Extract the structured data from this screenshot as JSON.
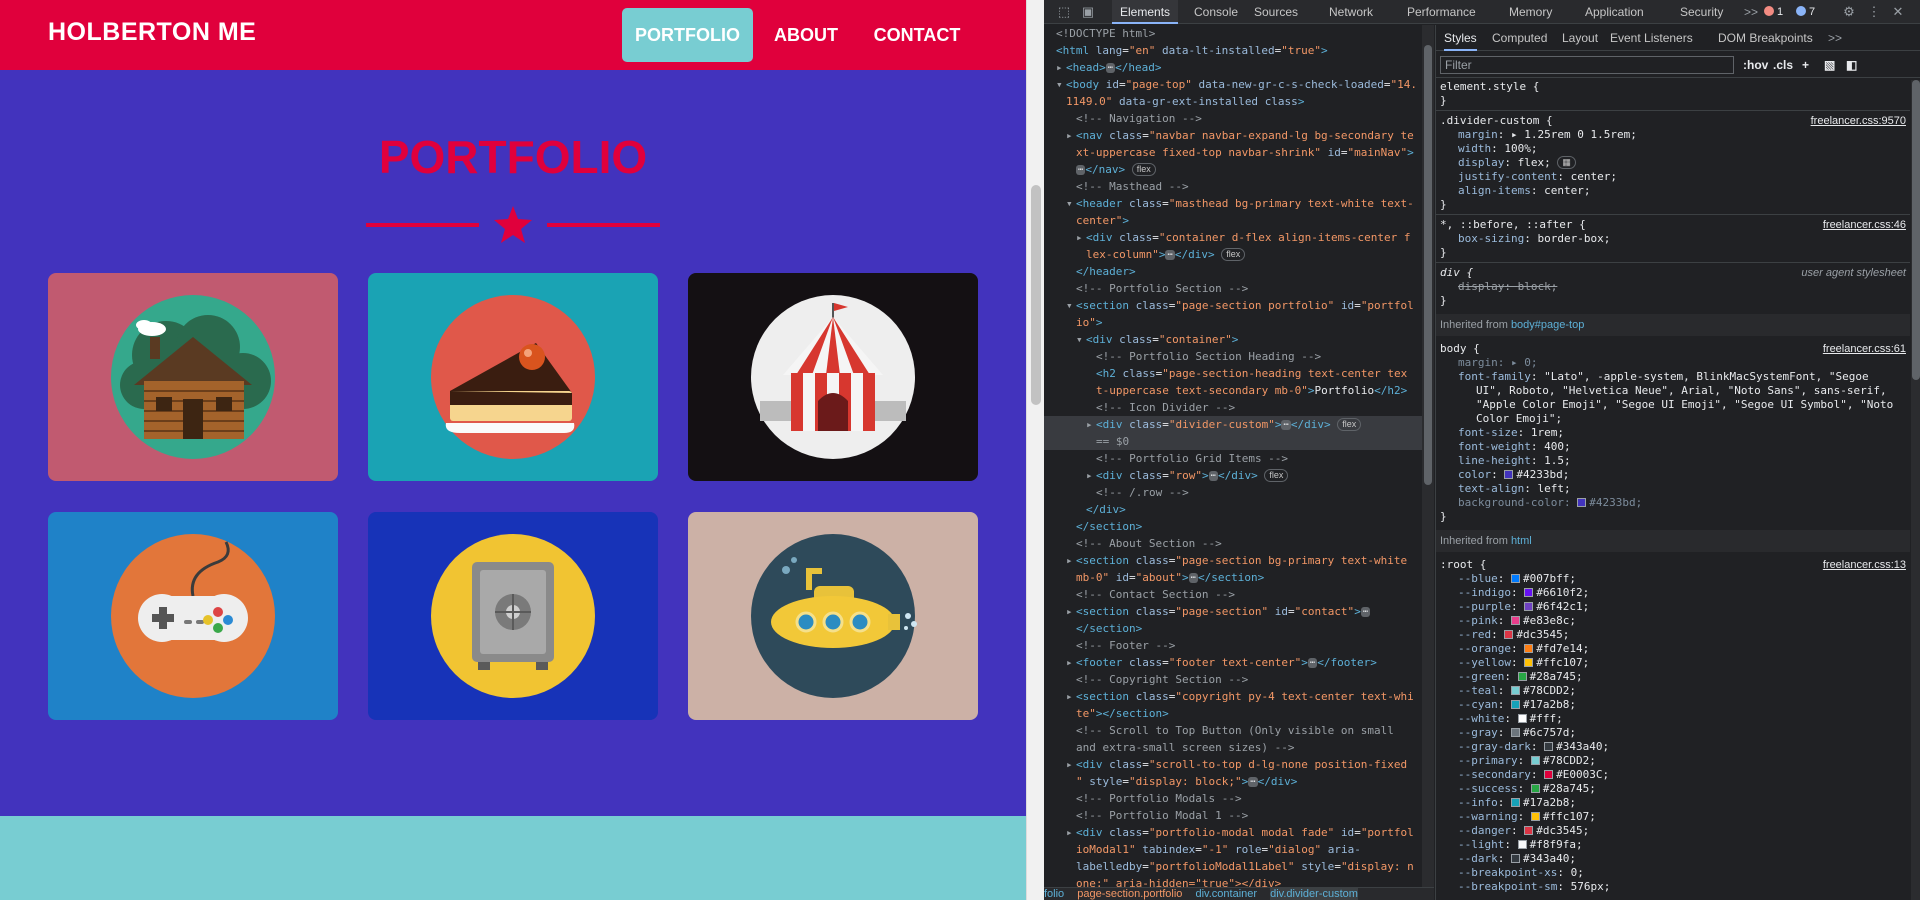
{
  "site": {
    "brand": "HOLBERTON ME",
    "nav": [
      "PORTFOLIO",
      "ABOUT",
      "CONTACT"
    ],
    "heading": "PORTFOLIO",
    "colors": {
      "primary": "#4233bd",
      "secondary": "#e0003c",
      "accent": "#78cdd2"
    },
    "portfolio_items": [
      {
        "name": "cabin",
        "bg": "#c15a70"
      },
      {
        "name": "cake",
        "bg": "#1aa3b4"
      },
      {
        "name": "circus",
        "bg": "#141013"
      },
      {
        "name": "game-controller",
        "bg": "#1f82c8"
      },
      {
        "name": "safe",
        "bg": "#1733b8"
      },
      {
        "name": "submarine",
        "bg": "#ccb1a6"
      }
    ]
  },
  "devtools": {
    "tabs": [
      "Elements",
      "Console",
      "Sources",
      "Network",
      "Performance",
      "Memory",
      "Application",
      "Security"
    ],
    "more_tabs": ">>",
    "errors": "1",
    "warnings": "7",
    "styles_tabs": [
      "Styles",
      "Computed",
      "Layout",
      "Event Listeners",
      "DOM Breakpoints"
    ],
    "filter_placeholder": "Filter",
    "hov": ":hov",
    "cls": ".cls",
    "dom": {
      "l1": "<!DOCTYPE html>",
      "l2_attr": "lang",
      "l2_val": "\"en\"",
      "l2_attr2": "data-lt-installed",
      "l2_val2": "\"true\"",
      "head": "<head>",
      "head_close": "</head>",
      "body_id": "\"page-top\"",
      "body_attr2": "data-new-gr-c-s-check-loaded",
      "body_val2": "\"14.",
      "body_cont": "1149.0\"",
      "body_attr3": "data-gr-ext-installed",
      "body_attr4": "class",
      "c_nav": "<!-- Navigation -->",
      "nav_class": "\"navbar navbar-expand-lg bg-secondary te",
      "nav_class2": "xt-uppercase fixed-top navbar-shrink\"",
      "nav_id": "\"mainNav\"",
      "nav_close": "</nav>",
      "pill_flex": "flex",
      "c_mast": "<!-- Masthead -->",
      "hdr_class": "\"masthead bg-primary text-white text-",
      "hdr_class2": "center\"",
      "div_class": "\"container d-flex align-items-center f",
      "div_class2": "lex-column\"",
      "div_close": "</div>",
      "hdr_close": "</header>",
      "c_port": "<!-- Portfolio Section -->",
      "sec_class": "\"page-section portfolio\"",
      "sec_id": "\"portfol",
      "sec_id2": "io\"",
      "cont_class": "\"container\"",
      "c_heading": "<!-- Portfolio Section Heading -->",
      "h2_class": "\"page-section-heading text-center tex",
      "h2_class2": "t-uppercase text-secondary mb-0\"",
      "h2_text": "Portfolio",
      "c_icon": "<!-- Icon Divider -->",
      "divider_class": "\"divider-custom\"",
      "eq_sel": "== $0",
      "c_grid": "<!-- Portfolio Grid Items -->",
      "row_class": "\"row\"",
      "c_row": "<!-- /.row -->",
      "sec_close": "</section>",
      "c_about": "<!-- About Section -->",
      "about_class": "\"page-section bg-primary text-white",
      "about_class2": "mb-0\"",
      "about_id": "\"about\"",
      "c_contact": "<!-- Contact Section -->",
      "contact_class": "\"page-section\"",
      "contact_id": "\"contact\"",
      "c_footer": "<!-- Footer -->",
      "footer_class": "\"footer text-center\"",
      "footer_close": "</footer>",
      "c_copy": "<!-- Copyright Section -->",
      "copy_class": "\"copyright py-4 text-center text-whi",
      "copy_class2": "te\"",
      "c_scroll": "<!-- Scroll to Top Button (Only visible on small",
      "c_scroll2": "and extra-small screen sizes) -->",
      "scroll_class": "\"scroll-to-top d-lg-none position-fixed",
      "scroll_class2": "\"",
      "scroll_style": "\"display: block;\"",
      "c_modals": "<!-- Portfolio Modals -->",
      "c_modal1": "<!-- Portfolio Modal 1 -->",
      "modal_class": "\"portfolio-modal modal fade\"",
      "modal_id": "\"portfol",
      "modal_id2": "ioModal1\"",
      "modal_tab": "\"-1\"",
      "modal_role": "\"dialog\"",
      "modal_aria": "aria-",
      "modal_aria2": "labelledby",
      "modal_aria_val": "\"portfolioModal1Label\"",
      "modal_style": "\"display: n",
      "modal_last": "one;\" aria-hidden=\"true\"></div>"
    },
    "breadcrumb": [
      "folio",
      "page-section.portfolio",
      "div.container",
      "div.divider-custom"
    ],
    "styles": {
      "element_style": "element.style {",
      "r1_sel": ".divider-custom {",
      "r1_src": "freelancer.css:9570",
      "r1_props": [
        [
          "margin",
          "▸ 1.25rem 0 1.5rem;"
        ],
        [
          "width",
          "100%;"
        ],
        [
          "display",
          "flex;"
        ],
        [
          "justify-content",
          "center;"
        ],
        [
          "align-items",
          "center;"
        ]
      ],
      "r2_sel": "*, ::before, ::after {",
      "r2_src": "freelancer.css:46",
      "r2_prop": [
        "box-sizing",
        "border-box;"
      ],
      "r3_sel": "div {",
      "r3_src": "user agent stylesheet",
      "r3_prop": [
        "display",
        "block;"
      ],
      "inh1_label": "Inherited from",
      "inh1_link": "body#page-top",
      "r4_sel": "body {",
      "r4_src": "freelancer.css:61",
      "r4_margin": "▸ 0;",
      "r4_ff": "\"Lato\", -apple-system, BlinkMacSystemFont, \"Segoe",
      "r4_ff2": "UI\", Roboto, \"Helvetica Neue\", Arial, \"Noto Sans\", sans-serif,",
      "r4_ff3": "\"Apple Color Emoji\", \"Segoe UI Emoji\", \"Segoe UI Symbol\", \"Noto",
      "r4_ff4": "Color Emoji\";",
      "r4_props": [
        [
          "font-size",
          "1rem;"
        ],
        [
          "font-weight",
          "400;"
        ],
        [
          "line-height",
          "1.5;"
        ],
        [
          "color",
          "#4233bd;"
        ],
        [
          "text-align",
          "left;"
        ],
        [
          "background-color",
          "#4233bd;"
        ]
      ],
      "inh2_label": "Inherited from",
      "inh2_link": "html",
      "r5_sel": ":root {",
      "r5_src": "freelancer.css:13",
      "vars": [
        [
          "--blue",
          "#007bff;",
          "#007bff"
        ],
        [
          "--indigo",
          "#6610f2;",
          "#6610f2"
        ],
        [
          "--purple",
          "#6f42c1;",
          "#6f42c1"
        ],
        [
          "--pink",
          "#e83e8c;",
          "#e83e8c"
        ],
        [
          "--red",
          "#dc3545;",
          "#dc3545"
        ],
        [
          "--orange",
          "#fd7e14;",
          "#fd7e14"
        ],
        [
          "--yellow",
          "#ffc107;",
          "#ffc107"
        ],
        [
          "--green",
          "#28a745;",
          "#28a745"
        ],
        [
          "--teal",
          "#78CDD2;",
          "#78CDD2"
        ],
        [
          "--cyan",
          "#17a2b8;",
          "#17a2b8"
        ],
        [
          "--white",
          "#fff;",
          "#ffffff"
        ],
        [
          "--gray",
          "#6c757d;",
          "#6c757d"
        ],
        [
          "--gray-dark",
          "#343a40;",
          "#343a40"
        ],
        [
          "--primary",
          "#78CDD2;",
          "#78CDD2"
        ],
        [
          "--secondary",
          "#E0003C;",
          "#E0003C"
        ],
        [
          "--success",
          "#28a745;",
          "#28a745"
        ],
        [
          "--info",
          "#17a2b8;",
          "#17a2b8"
        ],
        [
          "--warning",
          "#ffc107;",
          "#ffc107"
        ],
        [
          "--danger",
          "#dc3545;",
          "#dc3545"
        ],
        [
          "--light",
          "#f8f9fa;",
          "#f8f9fa"
        ],
        [
          "--dark",
          "#343a40;",
          "#343a40"
        ],
        [
          "--breakpoint-xs",
          "0;",
          ""
        ],
        [
          "--breakpoint-sm",
          "576px;",
          ""
        ]
      ]
    }
  }
}
